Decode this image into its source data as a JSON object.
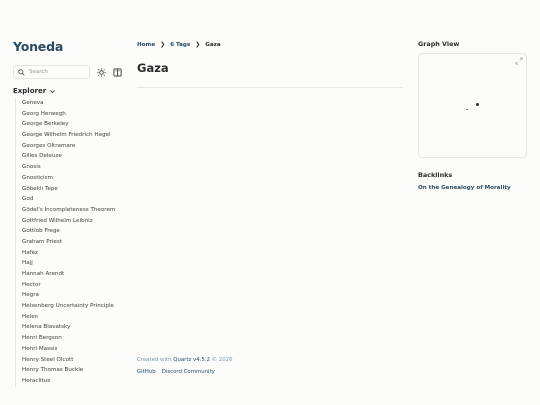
{
  "site": {
    "title": "Yoneda"
  },
  "search": {
    "placeholder": "Search"
  },
  "explorer": {
    "title": "Explorer",
    "items": [
      "Geneva",
      "Georg Herwegh",
      "George Berkeley",
      "George Wilhelm Friedrich Hegel",
      "Georges Oltramare",
      "Gilles Deleuze",
      "Gnosis",
      "Gnosticism",
      "Göbekli Tepe",
      "God",
      "Gödel's Incompleteness Theorem",
      "Gottfried Wilhelm Leibniz",
      "Gottlob Frege",
      "Graham Priest",
      "Hafez",
      "Hajj",
      "Hannah Arendt",
      "Hector",
      "Hegra",
      "Heisenberg Uncertainty Principle",
      "Helen",
      "Helena Blavatsky",
      "Henri Bergson",
      "Henri Massis",
      "Henry Steel Olcott",
      "Henry Thomas Buckle",
      "Heraclitus"
    ]
  },
  "breadcrumbs": {
    "home": "Home",
    "tags": "6 Tags",
    "current": "Gaza"
  },
  "page": {
    "title": "Gaza"
  },
  "footer": {
    "created_prefix": "Created with",
    "quartz_link": "Quartz v4.5.2",
    "copyright": "© 2026",
    "links": [
      "GitHub",
      "Discord Community"
    ]
  },
  "graph": {
    "title": "Graph View"
  },
  "backlinks": {
    "title": "Backlinks",
    "items": [
      "On the Genealogy of Morality"
    ]
  },
  "icons": {
    "search": "search-icon",
    "theme": "sun-icon",
    "reader": "book-icon",
    "chevron": "chevron-down-icon",
    "expand": "expand-icon"
  },
  "colors": {
    "accent": "#284b63",
    "text": "#2b2b2b",
    "background": "#fcfcfb",
    "border": "#e6e6e6"
  }
}
